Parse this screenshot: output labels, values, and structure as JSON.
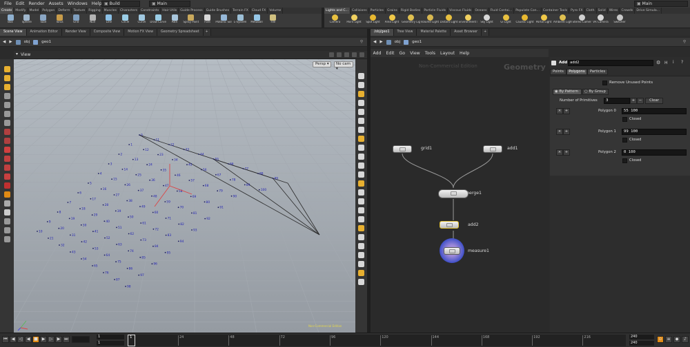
{
  "menubar": {
    "items": [
      "File",
      "Edit",
      "Render",
      "Assets",
      "Windows",
      "Help"
    ],
    "build_label": "Build",
    "desktop_label": "Main",
    "right_desktop_label": "Main"
  },
  "shelf_tabs_left": [
    "Create",
    "Modify",
    "Model",
    "Polygon",
    "Deform",
    "Texture",
    "Rigging",
    "Muscles",
    "Characters",
    "Constraints",
    "Hair Utils",
    "Guide Process",
    "Guide Brushes",
    "Terrain FX",
    "Cloud FX",
    "Volume"
  ],
  "shelf_tabs_right": [
    "Lights and C...",
    "Collisions",
    "Particles",
    "Grains",
    "Rigid Bodies",
    "Particle Fluids",
    "Viscous Fluids",
    "Oceans",
    "Fluid Contai...",
    "Populate Con...",
    "Container Tools",
    "Pyro FX",
    "Cloth",
    "Solid",
    "Wires",
    "Crowds",
    "Drive Simula..."
  ],
  "create_tools": [
    "Box",
    "Sphere",
    "Tube",
    "Torus",
    "Grid",
    "Null",
    "Line",
    "Circle",
    "Curve",
    "Draw Curve",
    "Path",
    "Spray Paint",
    "Font",
    "Platonic Solids",
    "L-System",
    "Metaball",
    "File"
  ],
  "light_tools": [
    "Camera",
    "Point Light",
    "Spot Light",
    "Area Light",
    "Geometry Light",
    "Volume Light",
    "Distant Light",
    "Environment Light",
    "Sky Light",
    "GI Light",
    "Caustic Light",
    "Portal Light",
    "Ambient Light",
    "Stereo Camera",
    "VR Camera",
    "Switcher"
  ],
  "pane_tabs_left": [
    "Scene View",
    "Animation Editor",
    "Render View",
    "Composite View",
    "Motion FX View",
    "Geometry Spreadsheet"
  ],
  "pane_tabs_right": [
    "/obj/geo1",
    "Tree View",
    "Material Palette",
    "Asset Browser"
  ],
  "left_path": {
    "obj": "obj",
    "geo": "geo1"
  },
  "right_path": {
    "obj": "obj",
    "geo": "geo1"
  },
  "viewport": {
    "title": "View",
    "persp": "Persp",
    "cam": "No cam",
    "footer_note": "Non-Commercial Edition"
  },
  "network_menu": [
    "Add",
    "Edit",
    "Go",
    "View",
    "Tools",
    "Layout",
    "Help"
  ],
  "network": {
    "watermark_edition": "Non-Commercial Edition",
    "watermark_context": "Geometry",
    "nodes": [
      "grid1",
      "add1",
      "merge1",
      "add2",
      "measure1"
    ]
  },
  "params": {
    "node_type": "Add",
    "node_name": "add2",
    "tabs": [
      "Points",
      "Polygons",
      "Particles"
    ],
    "remove_unused": "Remove Unused Points",
    "by_pattern": "By Pattern",
    "by_group": "By Group",
    "num_prims_label": "Number of Primitives",
    "num_prims": "3",
    "clear": "Clear",
    "closed_label": "Closed",
    "polygons": [
      {
        "label": "Polygon 0",
        "value": "55 100"
      },
      {
        "label": "Polygon 1",
        "value": "99 100"
      },
      {
        "label": "Polygon 2",
        "value": "0 100"
      }
    ]
  },
  "timeline": {
    "start": "1",
    "cur": "1",
    "ticks": [
      "24",
      "48",
      "72",
      "96",
      "120",
      "144",
      "168",
      "192",
      "216"
    ],
    "end1": "240",
    "end2": "240"
  },
  "point_numbers": [
    "0",
    "1",
    "2",
    "3",
    "4",
    "5",
    "6",
    "7",
    "8",
    "9",
    "10",
    "11",
    "12",
    "13",
    "14",
    "15",
    "16",
    "17",
    "18",
    "19",
    "20",
    "21",
    "22",
    "23",
    "24",
    "25",
    "26",
    "27",
    "28",
    "29",
    "30",
    "31",
    "32",
    "33",
    "34",
    "35",
    "36",
    "37",
    "38",
    "39",
    "40",
    "41",
    "42",
    "43",
    "44",
    "45",
    "46",
    "47",
    "48",
    "49",
    "50",
    "51",
    "52",
    "53",
    "54",
    "55",
    "56",
    "57",
    "58",
    "59",
    "60",
    "61",
    "62",
    "63",
    "64",
    "65",
    "66",
    "67",
    "68",
    "69",
    "70",
    "71",
    "72",
    "73",
    "74",
    "75",
    "76",
    "77",
    "78",
    "79",
    "80",
    "81",
    "82",
    "83",
    "84",
    "85",
    "86",
    "87",
    "88",
    "89",
    "90",
    "91",
    "92",
    "93",
    "94",
    "95",
    "96",
    "97",
    "98",
    "99",
    "100"
  ],
  "colors": {
    "accent": "#f0a020",
    "point_num": "#1f1fb4",
    "selection": "#e0c030"
  }
}
